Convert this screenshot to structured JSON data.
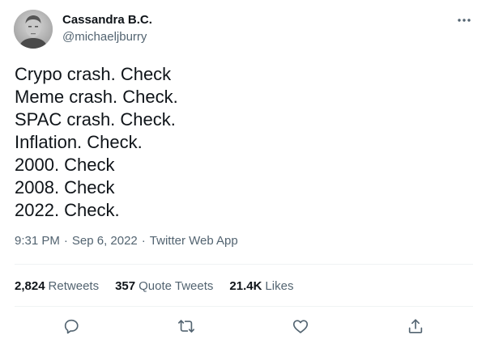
{
  "author": {
    "display_name": "Cassandra B.C.",
    "handle": "@michaeljburry",
    "avatar_icon": "profile-photo"
  },
  "tweet": {
    "lines": [
      "Crypo crash. Check",
      "Meme crash. Check.",
      "SPAC crash. Check.",
      "Inflation. Check.",
      "2000. Check",
      "2008. Check",
      "2022. Check."
    ]
  },
  "meta": {
    "time": "9:31 PM",
    "separator": "·",
    "date": "Sep 6, 2022",
    "source": "Twitter Web App"
  },
  "stats": {
    "retweets": {
      "count": "2,824",
      "label": "Retweets"
    },
    "quote_tweets": {
      "count": "357",
      "label": "Quote Tweets"
    },
    "likes": {
      "count": "21.4K",
      "label": "Likes"
    }
  },
  "icons": {
    "more": "more-horizontal-icon",
    "reply": "reply-icon",
    "retweet": "retweet-icon",
    "like": "like-icon",
    "share": "share-icon"
  },
  "colors": {
    "text": "#0f1419",
    "secondary": "#536471",
    "divider": "#eff3f4"
  }
}
